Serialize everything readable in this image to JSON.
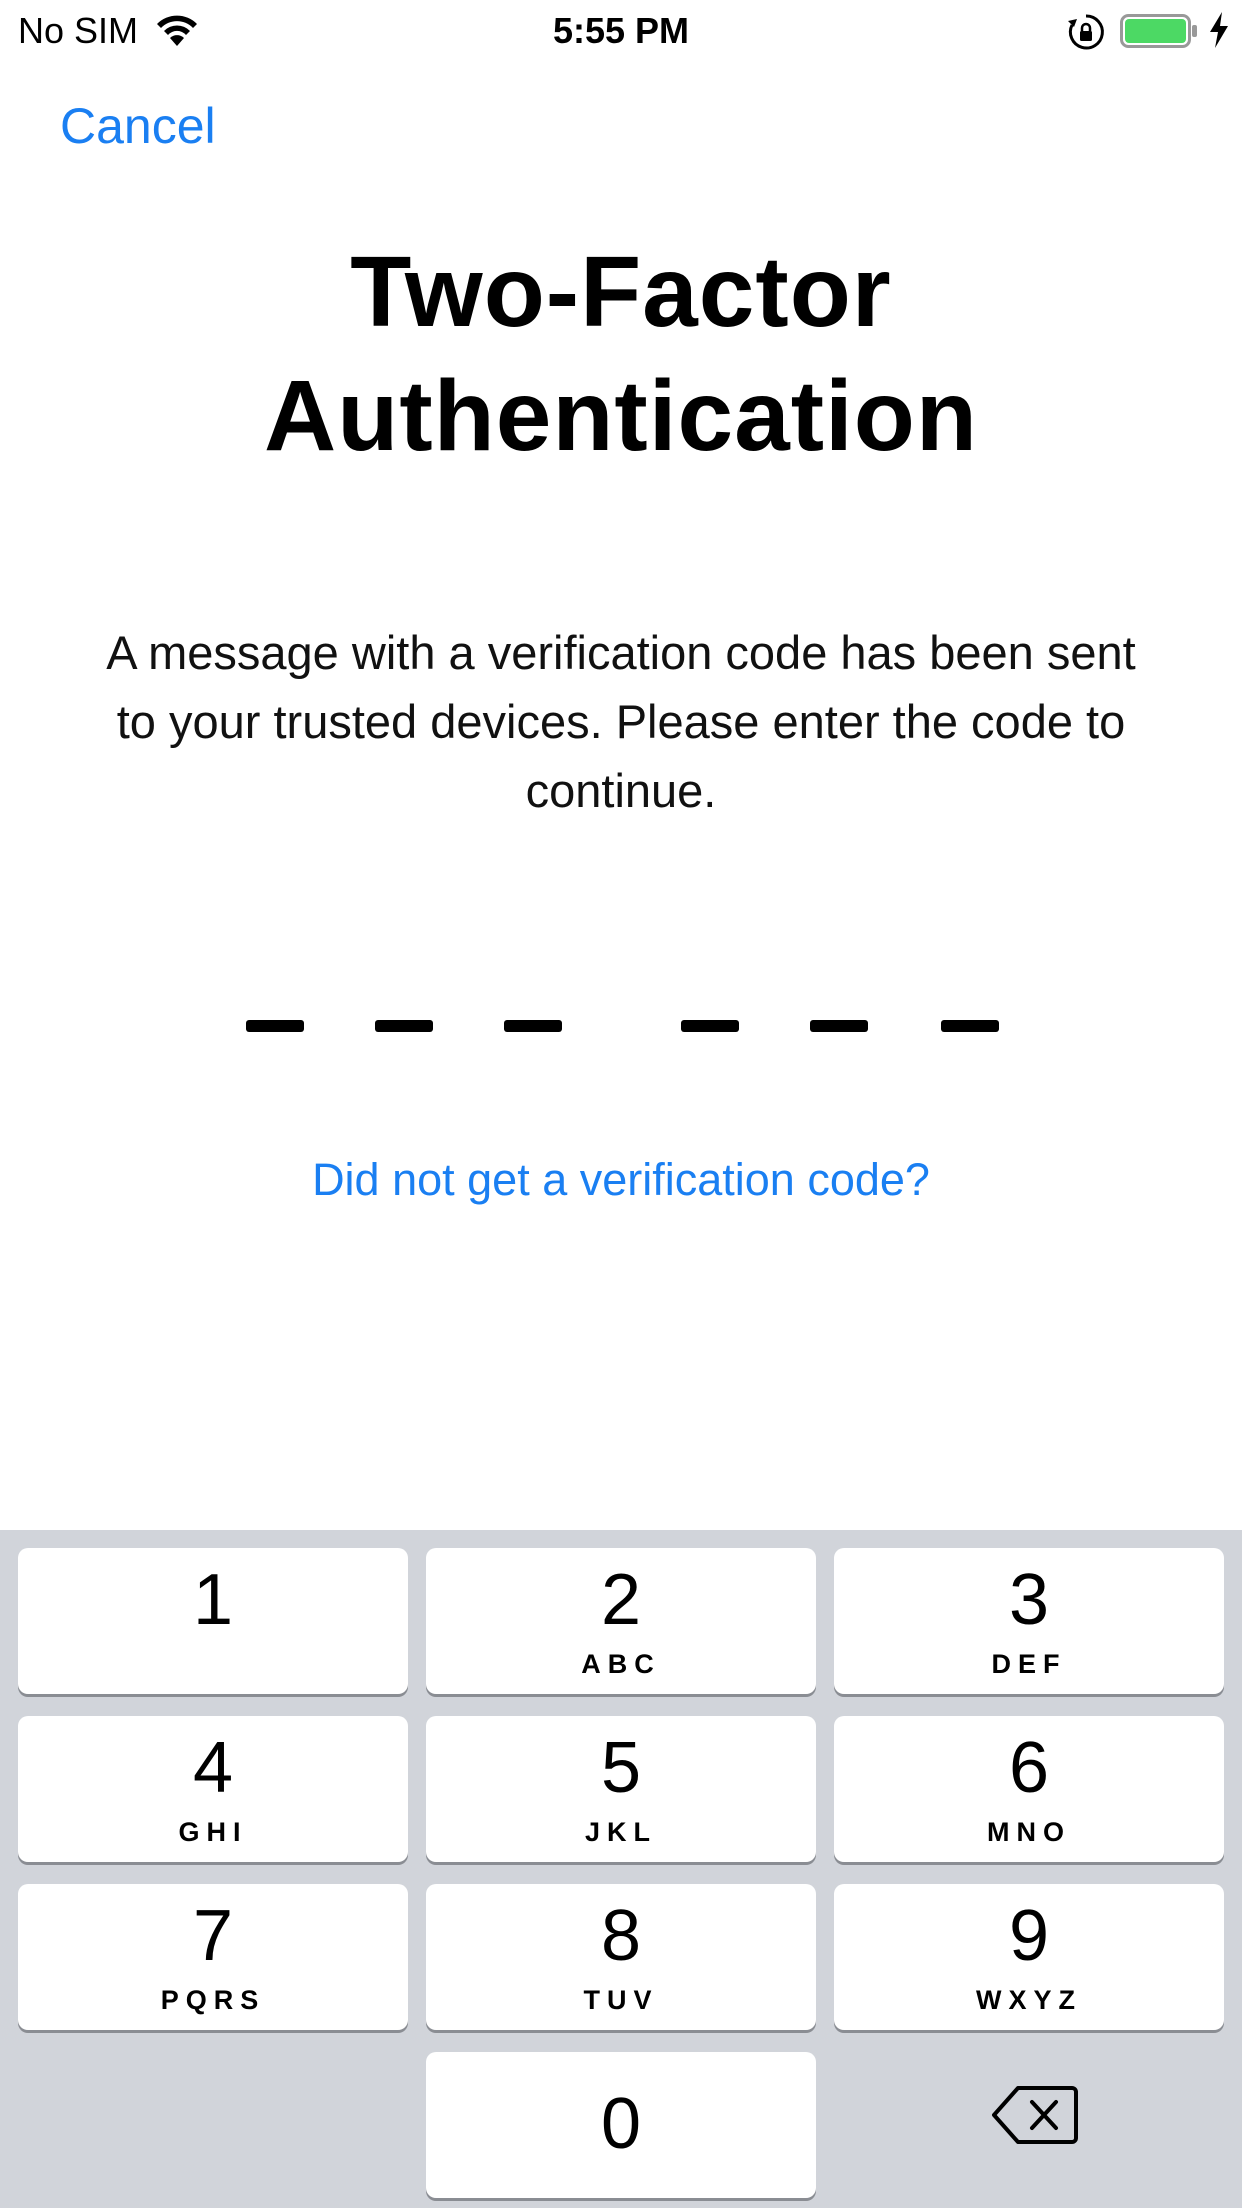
{
  "status_bar": {
    "carrier": "No SIM",
    "time": "5:55 PM",
    "battery_color": "#4cd964"
  },
  "nav": {
    "cancel_label": "Cancel"
  },
  "title": {
    "line1": "Two-Factor",
    "line2": "Authentication"
  },
  "message": {
    "line1": "A message with a verification code has been sent",
    "line2": "to your trusted devices. Please enter the code to",
    "line3": "continue."
  },
  "code_entry": {
    "entered_value": "",
    "slot_count": 6
  },
  "help": {
    "resend_label": "Did not get a verification code?"
  },
  "keypad": {
    "keys": [
      {
        "digit": "1",
        "letters": ""
      },
      {
        "digit": "2",
        "letters": "ABC"
      },
      {
        "digit": "3",
        "letters": "DEF"
      },
      {
        "digit": "4",
        "letters": "GHI"
      },
      {
        "digit": "5",
        "letters": "JKL"
      },
      {
        "digit": "6",
        "letters": "MNO"
      },
      {
        "digit": "7",
        "letters": "PQRS"
      },
      {
        "digit": "8",
        "letters": "TUV"
      },
      {
        "digit": "9",
        "letters": "WXYZ"
      },
      {
        "digit": "0",
        "letters": ""
      }
    ],
    "delete_icon": "backspace-icon"
  },
  "colors": {
    "accent": "#1a7ff2",
    "keypad_background": "#d1d4da",
    "key_background": "#ffffff"
  }
}
